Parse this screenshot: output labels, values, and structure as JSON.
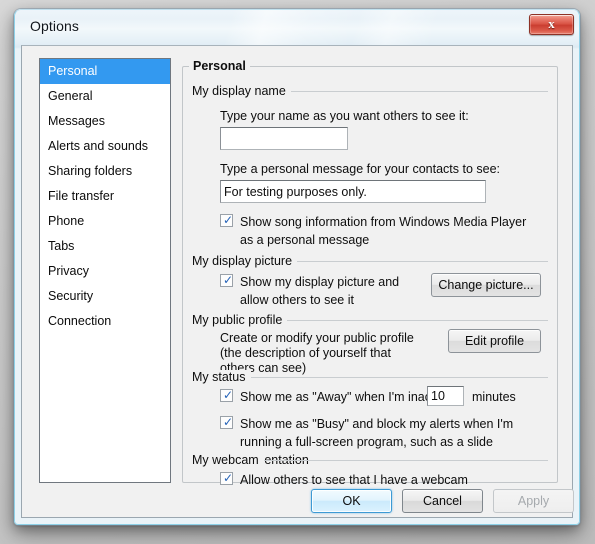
{
  "window": {
    "title": "Options",
    "close_label": "✕"
  },
  "sidebar": {
    "items": [
      {
        "label": "Personal",
        "selected": true
      },
      {
        "label": "General",
        "selected": false
      },
      {
        "label": "Messages",
        "selected": false
      },
      {
        "label": "Alerts and sounds",
        "selected": false
      },
      {
        "label": "Sharing folders",
        "selected": false
      },
      {
        "label": "File transfer",
        "selected": false
      },
      {
        "label": "Phone",
        "selected": false
      },
      {
        "label": "Tabs",
        "selected": false
      },
      {
        "label": "Privacy",
        "selected": false
      },
      {
        "label": "Security",
        "selected": false
      },
      {
        "label": "Connection",
        "selected": false
      }
    ]
  },
  "panel": {
    "title": "Personal",
    "display_name": {
      "group_label": "My display name",
      "name_caption": "Type your name as you want others to see it:",
      "name_value": "",
      "message_caption": "Type a personal message for your contacts to see:",
      "message_value": "For testing purposes only.",
      "song_checkbox_label": "Show song information from Windows Media Player as a personal message",
      "song_checked": true
    },
    "display_picture": {
      "group_label": "My display picture",
      "checkbox_label": "Show my display picture and allow others to see it",
      "checked": true,
      "button_label": "Change picture..."
    },
    "public_profile": {
      "group_label": "My public profile",
      "description": "Create or modify your public profile (the description of yourself that others can see)",
      "button_label": "Edit profile"
    },
    "status": {
      "group_label": "My status",
      "away_label_before": "Show me as \"Away\" when I'm inactive :",
      "away_minutes": "10",
      "away_label_after": "minutes",
      "away_checked": true,
      "busy_label": "Show me as \"Busy\" and block my alerts when I'm running a full-screen program, such as a slide presentation",
      "busy_checked": true
    },
    "webcam": {
      "group_label": "My webcam",
      "checkbox_label": "Allow others to see that I have a webcam",
      "checked": true
    }
  },
  "buttons": {
    "ok": "OK",
    "cancel": "Cancel",
    "apply": "Apply"
  },
  "colors": {
    "selection_blue": "#3399f0",
    "check_blue": "#2563b8",
    "close_red": "#d74f40"
  }
}
